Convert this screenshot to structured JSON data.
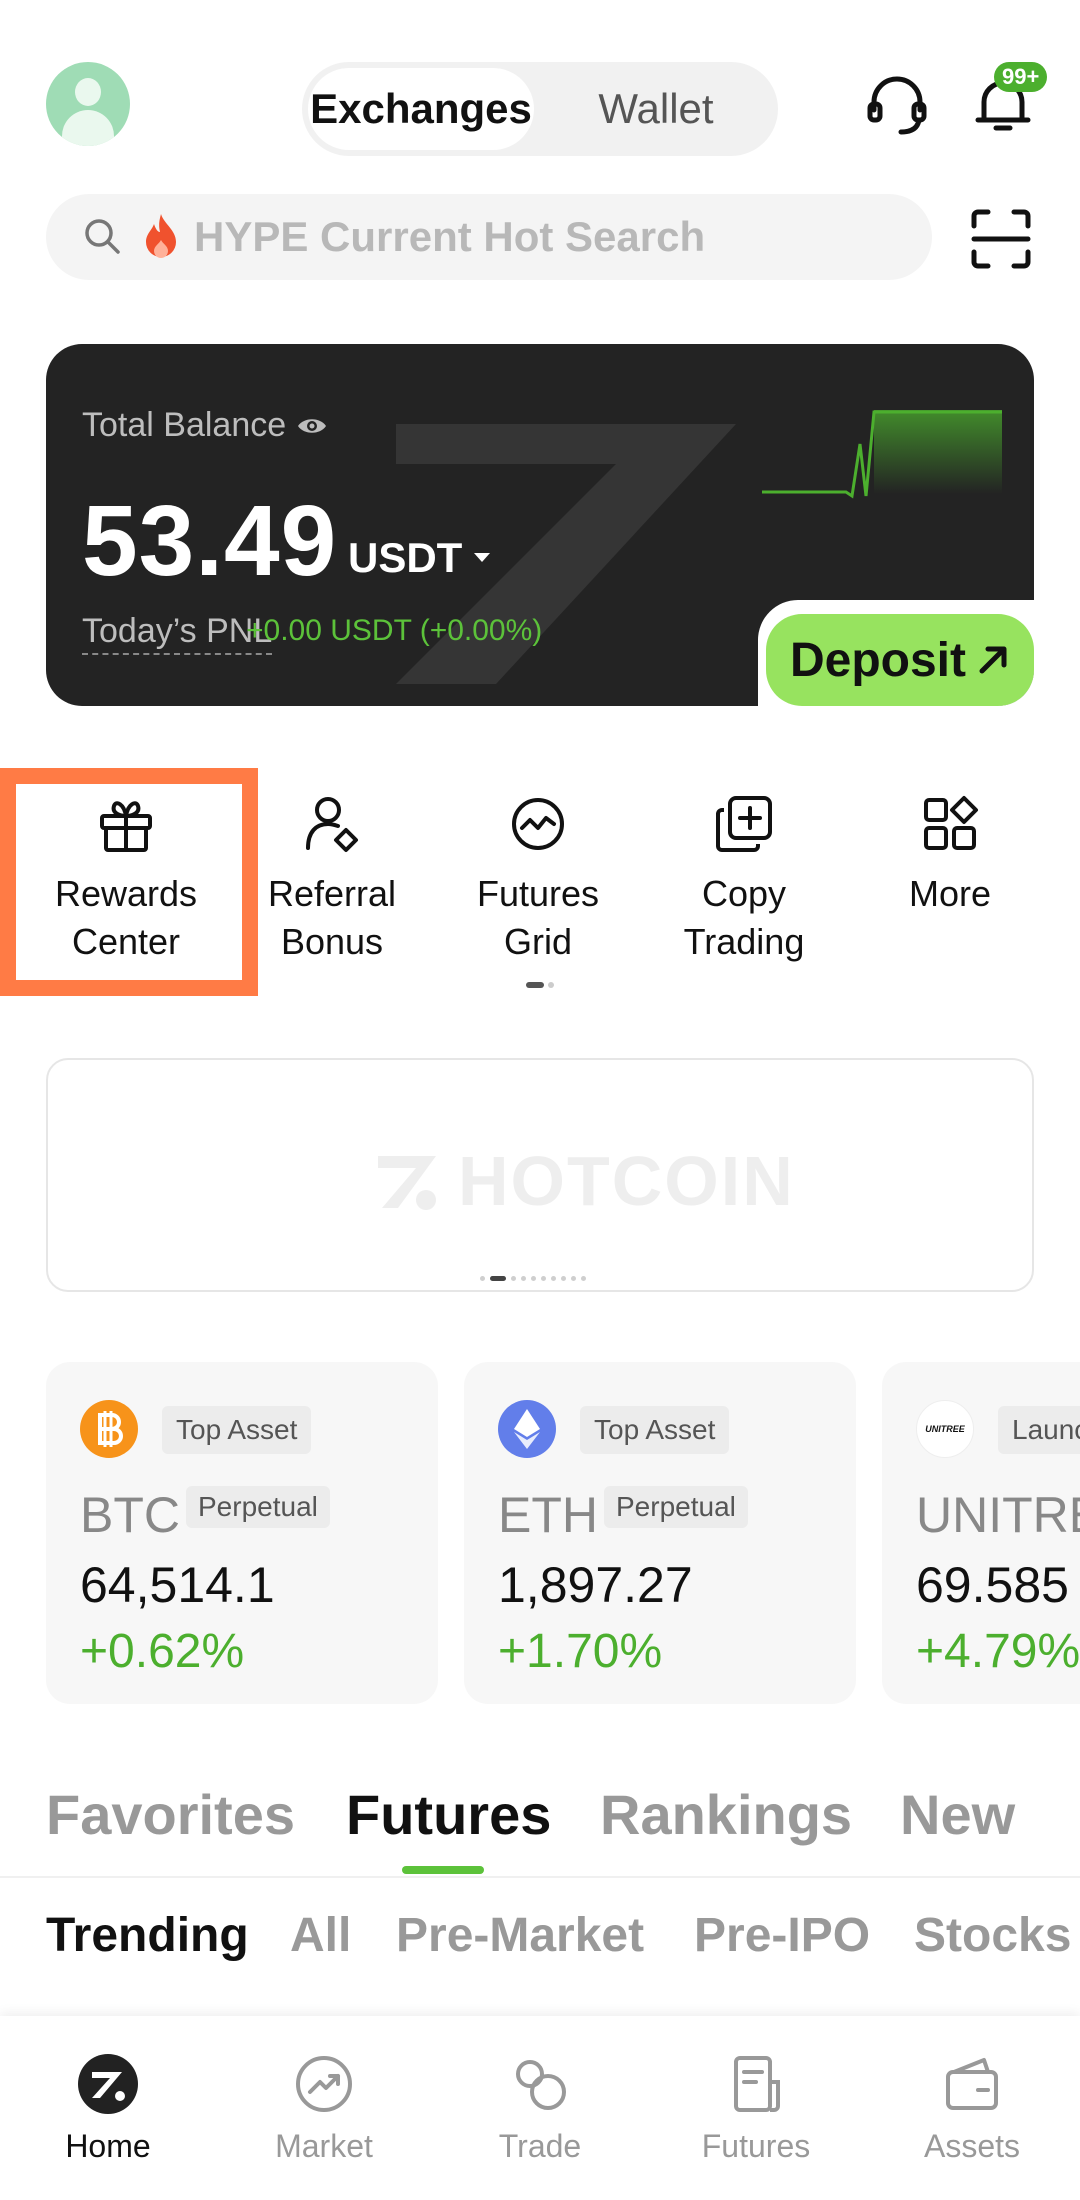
{
  "header": {
    "segments": [
      "Exchanges",
      "Wallet"
    ],
    "active_segment": "Exchanges",
    "notification_badge": "99+"
  },
  "search": {
    "placeholder": "HYPE Current Hot Search"
  },
  "balance": {
    "label": "Total Balance",
    "amount": "53.49",
    "unit": "USDT",
    "pnl_label": "Today’s PNL",
    "pnl_value": "+0.00 USDT (+0.00%)",
    "deposit_label": "Deposit"
  },
  "shortcuts": [
    {
      "label_line1": "Rewards",
      "label_line2": "Center"
    },
    {
      "label_line1": "Referral",
      "label_line2": "Bonus"
    },
    {
      "label_line1": "Futures",
      "label_line2": "Grid"
    },
    {
      "label_line1": "Copy",
      "label_line2": "Trading"
    },
    {
      "label_line1": "More",
      "label_line2": ""
    }
  ],
  "banner": {
    "brand": "HOTCOIN"
  },
  "assets": [
    {
      "tag": "Top Asset",
      "symbol": "BTC",
      "type": "Perpetual",
      "price": "64,514.1",
      "change": "+0.62%",
      "coin_color": "#f7931a"
    },
    {
      "tag": "Top Asset",
      "symbol": "ETH",
      "type": "Perpetual",
      "price": "1,897.27",
      "change": "+1.70%",
      "coin_color": "#627eea"
    },
    {
      "tag": "Launch",
      "symbol": "UNITREE",
      "type": "",
      "price": "69.585",
      "change": "+4.79%",
      "coin_logo_text": "UNITREE",
      "coin_color": "#ffffff"
    }
  ],
  "market_tabs": [
    "Favorites",
    "Futures",
    "Rankings",
    "New"
  ],
  "active_market_tab": "Futures",
  "sub_tabs": [
    "Trending",
    "All",
    "Pre-Market",
    "Pre-IPO",
    "Stocks"
  ],
  "active_sub_tab": "Trending",
  "bottom_nav": [
    "Home",
    "Market",
    "Trade",
    "Futures",
    "Assets"
  ],
  "active_nav": "Home",
  "colors": {
    "accent_green": "#5cc23a",
    "deposit_green": "#97e35f",
    "highlight_orange": "#ff7b45",
    "card_dark": "#232323"
  }
}
